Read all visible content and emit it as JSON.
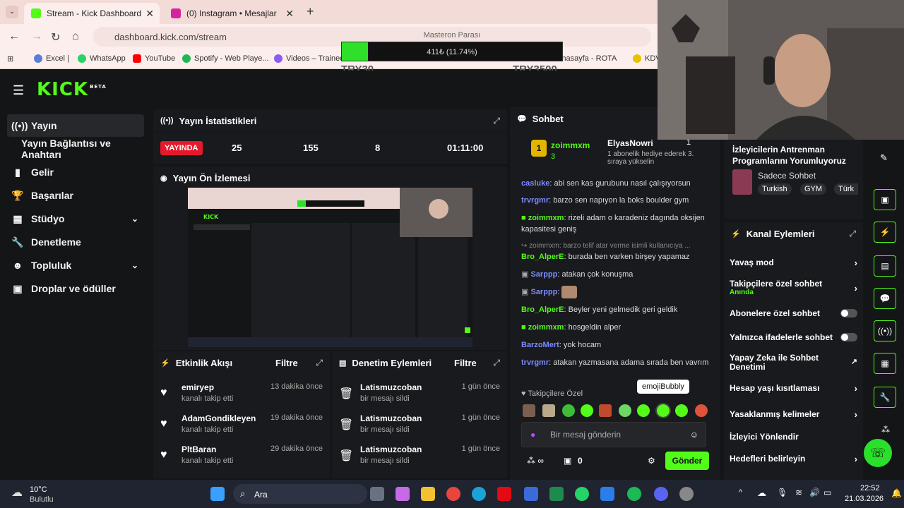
{
  "browser": {
    "tabs": [
      {
        "title": "Stream - Kick Dashboard",
        "active": true
      },
      {
        "title": "(0) Instagram • Mesajlar",
        "active": false
      }
    ],
    "url": "dashboard.kick.com/stream",
    "bookmarks": [
      "Excel |",
      "WhatsApp",
      "YouTube",
      "Spotify - Web Playe...",
      "Videos – Trained b",
      "Anasayfa - ROTA",
      "KDV"
    ]
  },
  "overlay": {
    "title": "Masteron Parası",
    "progress_text": "411₺ (11.74%)",
    "progress_percent": 11.74,
    "min": "TRY30",
    "max": "TRY3500"
  },
  "app": {
    "logo": "KICK",
    "logo_badge": "BETA",
    "sidebar": [
      {
        "label": "Yayın",
        "icon": "broadcast-icon",
        "active": true
      },
      {
        "label": "Yayın Bağlantısı ve Anahtarı"
      },
      {
        "label": "Gelir",
        "icon": "chart-icon"
      },
      {
        "label": "Başarılar",
        "icon": "trophy-icon"
      },
      {
        "label": "Stüdyo",
        "icon": "studio-icon",
        "chevron": true
      },
      {
        "label": "Denetleme",
        "icon": "wrench-icon"
      },
      {
        "label": "Topluluk",
        "icon": "people-icon",
        "chevron": true
      },
      {
        "label": "Droplar ve ödüller",
        "icon": "gift-icon"
      }
    ]
  },
  "stats": {
    "title": "Yayın İstatistikleri",
    "live": "YAYINDA",
    "viewers": "25",
    "followers": "155",
    "subs": "8",
    "duration": "01:11:00"
  },
  "preview": {
    "title": "Yayın Ön İzlemesi"
  },
  "activity": {
    "title": "Etkinlik Akışı",
    "filter": "Filtre",
    "items": [
      {
        "name": "emiryep",
        "action": "kanalı takip etti",
        "time": "13 dakika önce"
      },
      {
        "name": "AdamGondikleyen",
        "action": "kanalı takip etti",
        "time": "19 dakika önce"
      },
      {
        "name": "PltBaran",
        "action": "kanalı takip etti",
        "time": "29 dakika önce"
      }
    ]
  },
  "moderation": {
    "title": "Denetim Eylemleri",
    "filter": "Filtre",
    "items": [
      {
        "name": "Latismuzcoban",
        "action": "bir mesajı sildi",
        "time": "1 gün önce"
      },
      {
        "name": "Latismuzcoban",
        "action": "bir mesajı sildi",
        "time": "1 gün önce"
      },
      {
        "name": "Latismuzcoban",
        "action": "bir mesajı sildi",
        "time": "1 gün önce"
      }
    ]
  },
  "chat": {
    "title": "Sohbet",
    "pinned_user": "zoimmxm",
    "pinned_count": "3",
    "gift_user": "ElyasNowri",
    "gift_count": "1",
    "gift_text": "1 abonelik hediye ederek 3. sıraya yükselin",
    "messages": [
      {
        "user": "casluke",
        "text": "abi sen kas gurubunu nasıl çalışıyorsun",
        "color": "#7b8bff"
      },
      {
        "user": "trvrgmr",
        "text": "barzo sen napıyon la boks boulder gym",
        "color": "#7b8bff"
      },
      {
        "user": "zoimmxm",
        "text": "rizeli adam o karadeniz dagında oksijen kapasitesi geniş",
        "color": "#53fc18"
      },
      {
        "user": "",
        "text": "↪ zoimmxm: barzo telif atar verme isimli kullanıcıya ...",
        "color": "#888"
      },
      {
        "user": "Bro_AlperE",
        "text": "burada ben varken birşey yapamaz",
        "color": "#53fc18"
      },
      {
        "user": "Sarppp",
        "text": "atakan çok konuşma",
        "color": "#7b8bff"
      },
      {
        "user": "Sarppp",
        "text": "",
        "color": "#7b8bff"
      },
      {
        "user": "Bro_AlperE",
        "text": "Beyler yeni gelmedik geri geldik",
        "color": "#53fc18"
      },
      {
        "user": "zoimmxm",
        "text": "hosgeldin alper",
        "color": "#53fc18"
      },
      {
        "user": "BarzoMert",
        "text": "yok hocam",
        "color": "#7b8bff"
      },
      {
        "user": "trvrgmr",
        "text": "atakan yazmasana adama sırada ben vavrım",
        "color": "#7b8bff"
      }
    ],
    "subscriber_label": "Takipçilere Özel",
    "tooltip": "emojiBubbly",
    "input_placeholder": "Bir mesaj gönderin",
    "points": "0",
    "send": "Gönder"
  },
  "stream_info": {
    "title": "İzleyicilerin Antrenman Programlarını Yorumluyoruz",
    "category": "Sadece Sohbet",
    "tags": [
      "Turkish",
      "GYM",
      "Türk"
    ]
  },
  "channel_actions": {
    "title": "Kanal Eylemleri",
    "items": [
      {
        "label": "Yavaş mod",
        "type": "arrow"
      },
      {
        "label": "Takipçilere özel sohbet",
        "sub": "Anında",
        "type": "arrow"
      },
      {
        "label": "Abonelere özel sohbet",
        "type": "toggle"
      },
      {
        "label": "Yalnızca ifadelerle sohbet",
        "type": "toggle"
      },
      {
        "label": "Yapay Zeka ile Sohbet Denetimi",
        "type": "external"
      },
      {
        "label": "Hesap yaşı kısıtlaması",
        "type": "arrow"
      },
      {
        "label": "Yasaklanmış kelimeler",
        "type": "arrow"
      },
      {
        "label": "İzleyici Yönlendir",
        "type": "none"
      },
      {
        "label": "Hedefleri belirleyin",
        "type": "arrow"
      }
    ]
  },
  "taskbar": {
    "weather_temp": "10°C",
    "weather_desc": "Bulutlu",
    "search": "Ara",
    "time": "22:52",
    "date": "21.03.2026"
  },
  "colors": {
    "accent": "#53fc18",
    "live": "#e5192b"
  }
}
